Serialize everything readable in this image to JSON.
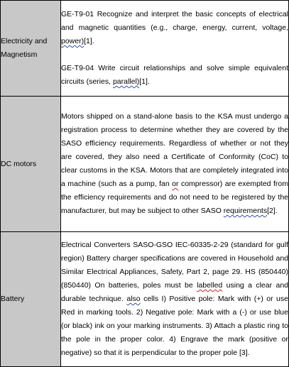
{
  "rows": [
    {
      "label": "Electricity and Magnetism",
      "p1_text": "GE-T9-01 Recognize and interpret the basic concepts of electrical and magnetic quantities (e.g., charge, energy, current, voltage, ",
      "p1_mark": "power)",
      "p1_ref": "[1].",
      "p2_text": "GE-T9-04 Write circuit relationships and solve simple equivalent circuits (series, ",
      "p2_mark": "parallel)",
      "p2_ref": "[1]."
    },
    {
      "label": "DC motors",
      "text_a": "Motors shipped on a stand-alone basis to the KSA must undergo a registration process to determine whether they are covered by the SASO efficiency requirements. Regardless of whether or not they are covered, they also need a Certificate of Conformity (CoC) to clear customs in the KSA. Motors that are completely integrated into a machine (such as a pump, fan ",
      "mark_or": "or",
      "text_b": " compressor) are exempted from the efficiency requirements and do not need to be registered by the manufacturer, but may be subject to other SASO ",
      "mark_req": "requirements",
      "ref": "[2]."
    },
    {
      "label": "Battery",
      "text_a": "Electrical Converters SASO-GSO IEC-60335-2-29 (standard for gulf region) Battery charger specifications are covered in Household and Similar Electrical Appliances, Safety, Part 2, page 29. HS (850440) (850440) On batteries, poles must be ",
      "mark_labelled": "labelled",
      "text_b": " using a clear and durable technique. ",
      "mark_also": "also",
      "text_c": " cells I) Positive pole: Mark with (+) or use Red in marking tools. 2) Negative pole: Mark with a (-) or use blue (or black) ink on your marking instruments. 3) Attach a plastic ring to the pole in the proper color. 4) Engrave the mark (positive or negative) so that it is perpendicular to the proper pole [3]."
    }
  ]
}
